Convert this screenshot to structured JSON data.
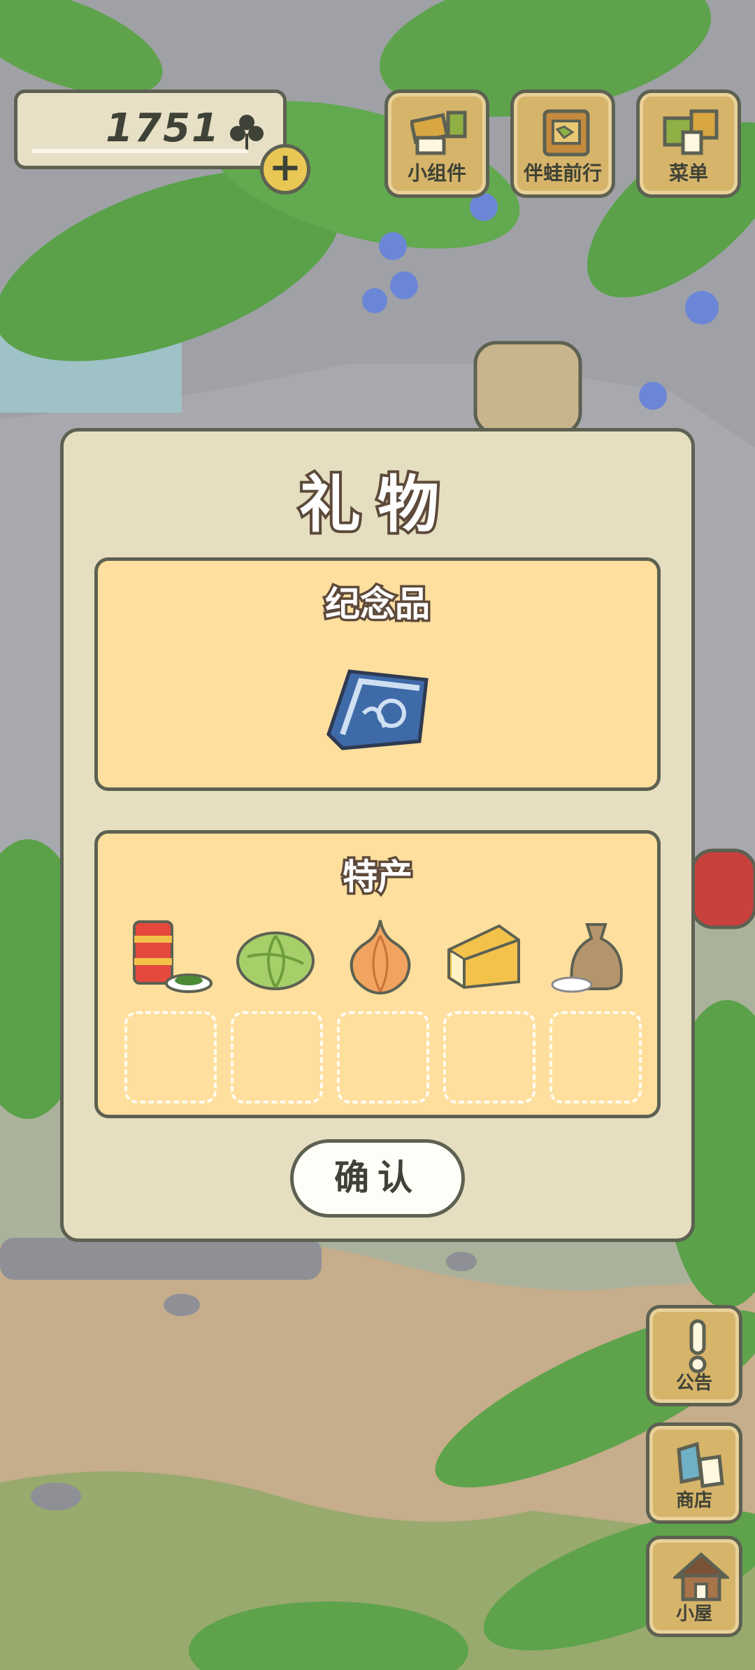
{
  "currency": {
    "count": "1751",
    "icon": "clover-icon",
    "add_icon": "plus"
  },
  "top_menu": [
    {
      "label": "小组件",
      "icon": "widget-icon"
    },
    {
      "label": "伴蛙前行",
      "icon": "journey-book-icon"
    },
    {
      "label": "菜单",
      "icon": "menu-cards-icon"
    }
  ],
  "side_menu": [
    {
      "label": "公告",
      "icon": "exclamation-icon"
    },
    {
      "label": "商店",
      "icon": "bag-icon"
    },
    {
      "label": "小屋",
      "icon": "house-icon"
    }
  ],
  "dialog": {
    "title": "礼物",
    "souvenir": {
      "title": "纪念品",
      "item": "folded-cloth-icon"
    },
    "specialty": {
      "title": "特产",
      "items": [
        "canned-food-icon",
        "cabbage-icon",
        "onion-icon",
        "cheese-icon",
        "rice-sack-icon"
      ],
      "slots": 5
    },
    "confirm_label": "确认"
  },
  "colors": {
    "outline": "#5d6152",
    "dialog_bg": "#e6dec0",
    "panel_bg": "#ffdf9e",
    "wood": "#d6b46a"
  }
}
